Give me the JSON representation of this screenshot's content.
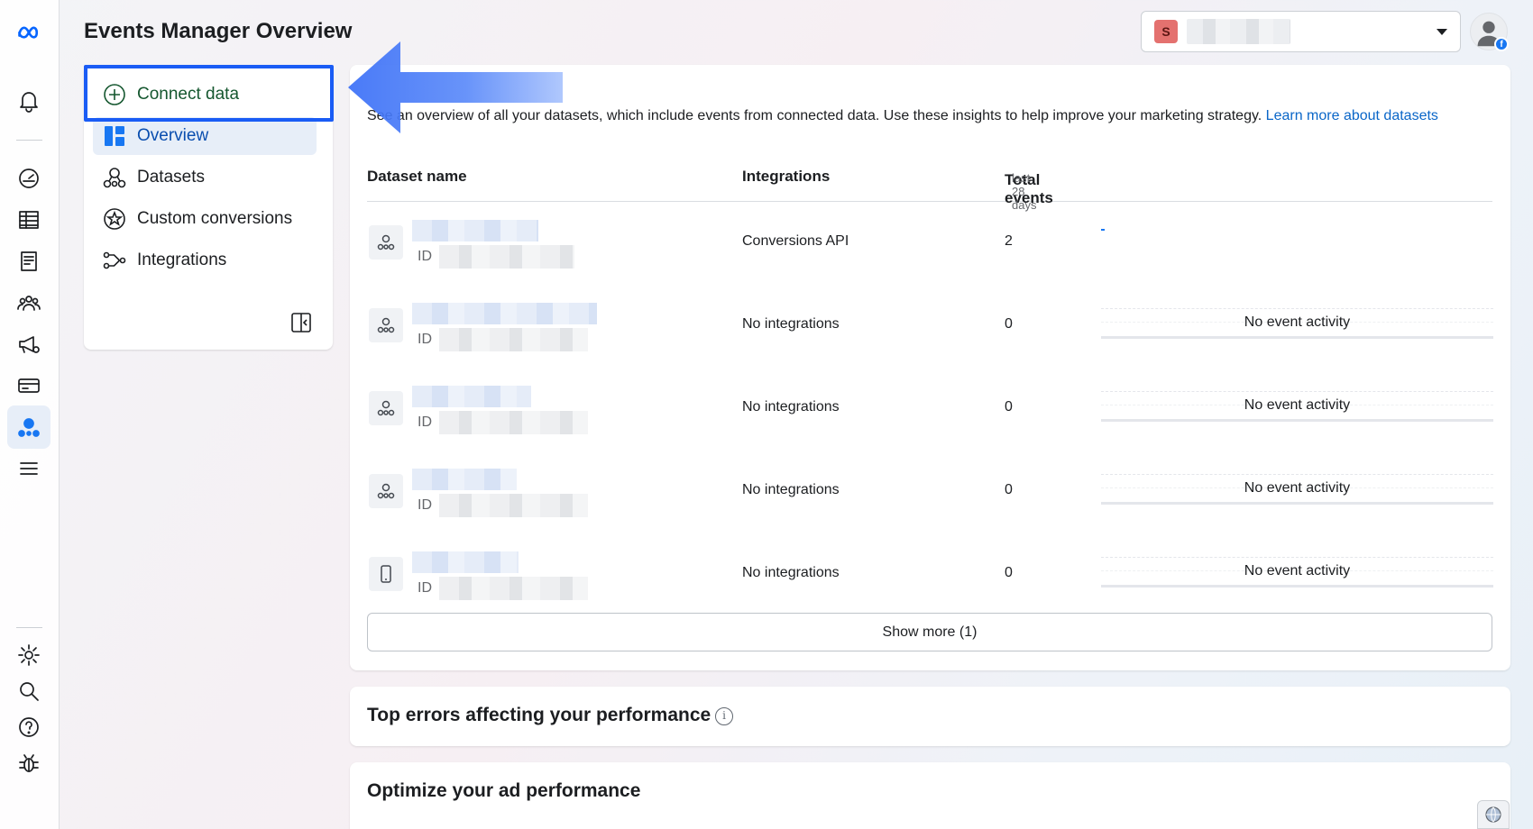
{
  "page": {
    "title": "Events Manager Overview"
  },
  "account": {
    "badge_letter": "S",
    "avatar_badge": "f"
  },
  "colors": {
    "accent": "#1877f2",
    "highlight": "#1a5cf5",
    "connect_green": "#15572f",
    "active_nav_bg": "#e7eef8"
  },
  "rail": {
    "icons": [
      "meta-logo-icon",
      "bell-icon",
      "dashboard-gauge-icon",
      "table-grid-icon",
      "pages-icon",
      "audience-icon",
      "ads-megaphone-icon",
      "billing-card-icon",
      "events-manager-icon",
      "menu-icon",
      "settings-gear-icon",
      "search-icon",
      "help-icon",
      "bug-icon"
    ]
  },
  "nav": {
    "items": [
      {
        "label": "Connect data",
        "icon": "plus-circle-icon"
      },
      {
        "label": "Overview",
        "icon": "overview-grid-icon"
      },
      {
        "label": "Datasets",
        "icon": "dataset-icon"
      },
      {
        "label": "Custom conversions",
        "icon": "star-badge-icon"
      },
      {
        "label": "Integrations",
        "icon": "integrations-icon"
      }
    ],
    "collapse_icon": "collapse-panel-icon"
  },
  "overview": {
    "description_prefix": "See an overview of all your datasets, which include events from connected data. Use these insights to help improve your marketing strategy.",
    "description_link": "Learn more about datasets",
    "headers": {
      "dataset": "Dataset name",
      "integrations": "Integrations",
      "total_events": "Total events",
      "period": "last 28 days"
    },
    "rows": [
      {
        "id_label": "ID",
        "integration": "Conversions API",
        "total": "2",
        "activity": "",
        "icon": "dataset-icon"
      },
      {
        "id_label": "ID",
        "integration": "No integrations",
        "total": "0",
        "activity": "No event activity",
        "icon": "dataset-icon"
      },
      {
        "id_label": "ID",
        "integration": "No integrations",
        "total": "0",
        "activity": "No event activity",
        "icon": "dataset-icon"
      },
      {
        "id_label": "ID",
        "integration": "No integrations",
        "total": "0",
        "activity": "No event activity",
        "icon": "dataset-icon"
      },
      {
        "id_label": "ID",
        "integration": "No integrations",
        "total": "0",
        "activity": "No event activity",
        "icon": "mobile-app-icon"
      }
    ],
    "show_more": "Show more (1)"
  },
  "errors_card": {
    "title": "Top errors affecting your performance"
  },
  "optimize_card": {
    "title": "Optimize your ad performance"
  }
}
